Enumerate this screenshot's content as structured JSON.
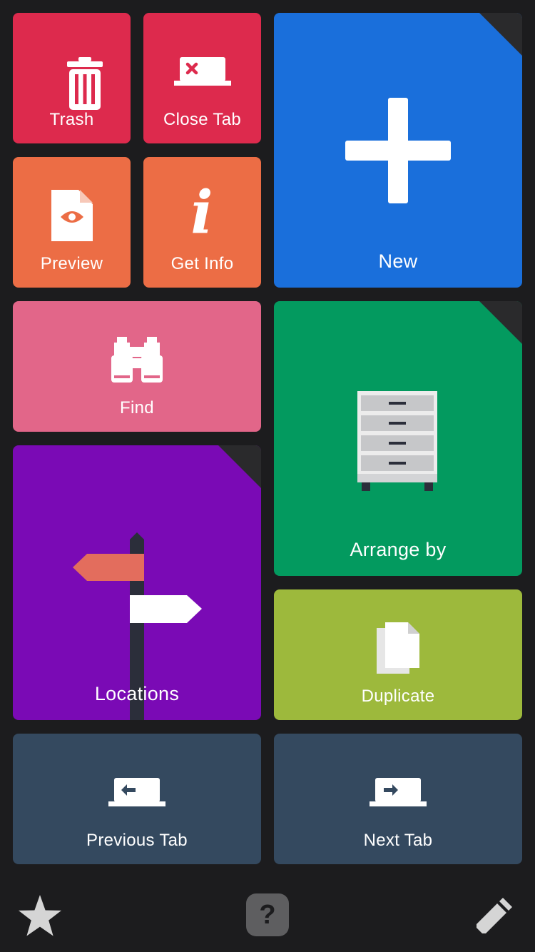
{
  "tiles": {
    "trash": {
      "label": "Trash",
      "color": "#dd2a4d"
    },
    "close_tab": {
      "label": "Close Tab",
      "color": "#dd2a4d"
    },
    "preview": {
      "label": "Preview",
      "color": "#ec6d45"
    },
    "get_info": {
      "label": "Get Info",
      "color": "#ec6d45"
    },
    "new": {
      "label": "New",
      "color": "#1a6fdb"
    },
    "find": {
      "label": "Find",
      "color": "#e26689"
    },
    "arrange_by": {
      "label": "Arrange by",
      "color": "#039a5f"
    },
    "locations": {
      "label": "Locations",
      "color": "#7a0ab5"
    },
    "duplicate": {
      "label": "Duplicate",
      "color": "#9db93c"
    },
    "previous_tab": {
      "label": "Previous Tab",
      "color": "#34495f"
    },
    "next_tab": {
      "label": "Next Tab",
      "color": "#34495f"
    }
  },
  "bottom_bar": {
    "favorites_icon": "star-icon",
    "help_icon": "question-icon",
    "help_glyph": "?",
    "edit_icon": "pencil-icon"
  }
}
